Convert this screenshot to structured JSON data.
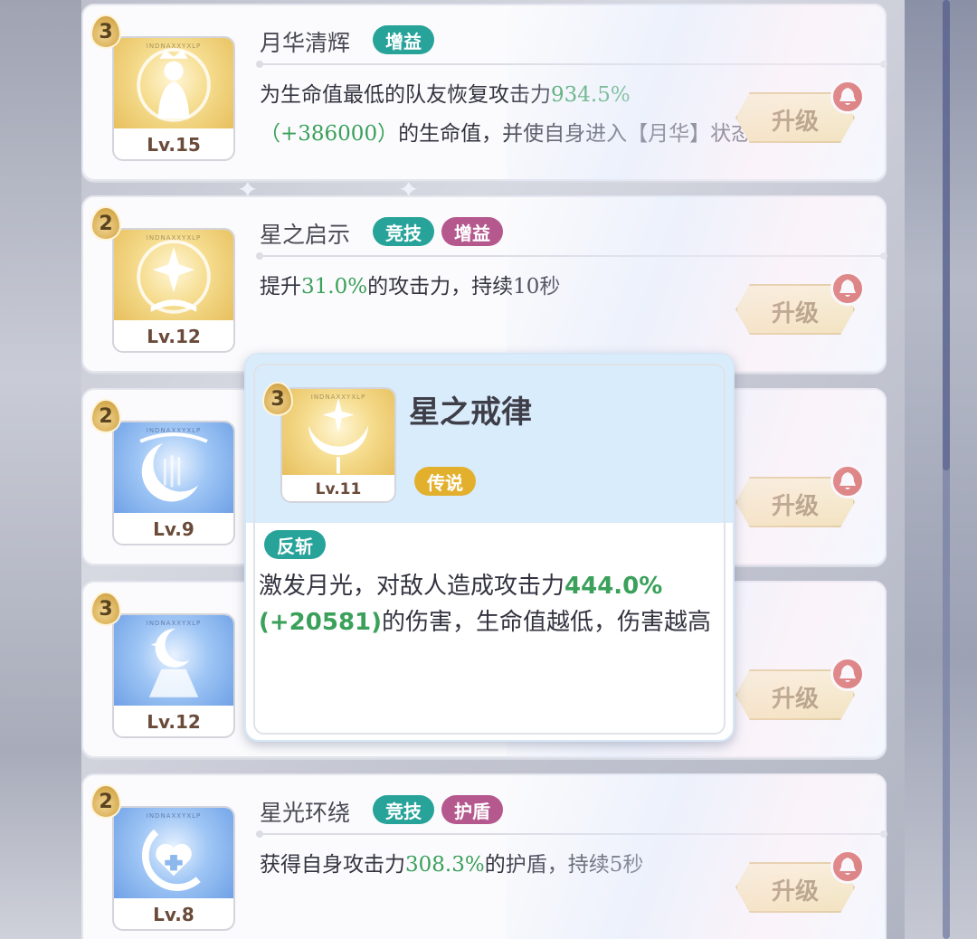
{
  "skills": [
    {
      "tier": "3",
      "name": "月华清辉",
      "icon_code": "INDNAXXYXLP",
      "level": "Lv.15",
      "tags": [
        {
          "label": "增益",
          "color": "teal"
        }
      ],
      "desc": {
        "pre": "为生命值最低的队友恢复攻击力",
        "hl": "934.5%（+386000）",
        "post": "的生命值，并使自身进入【月华】状态"
      },
      "icon": "praying-maiden-icon",
      "theme": "gold"
    },
    {
      "tier": "2",
      "name": "星之启示",
      "icon_code": "INDNAXXYXLP",
      "level": "Lv.12",
      "tags": [
        {
          "label": "竞技",
          "color": "teal"
        },
        {
          "label": "增益",
          "color": "purple"
        }
      ],
      "desc": {
        "pre": "提升",
        "hl": "31.0%",
        "post": "的攻击力，持续10秒"
      },
      "icon": "sparkle-book-icon",
      "theme": "gold"
    },
    {
      "tier": "2",
      "icon_code": "INDNAXXYXLP",
      "level": "Lv.9",
      "icon": "crescent-moon-icon",
      "theme": "blue"
    },
    {
      "tier": "3",
      "icon_code": "INDNAXXYXLP",
      "level": "Lv.12",
      "icon": "moon-pendant-icon",
      "theme": "blue"
    },
    {
      "tier": "2",
      "name": "星光环绕",
      "icon_code": "INDNAXXYXLP",
      "level": "Lv.8",
      "tags": [
        {
          "label": "竞技",
          "color": "teal"
        },
        {
          "label": "护盾",
          "color": "purple"
        }
      ],
      "desc": {
        "pre": "获得自身攻击力",
        "hl": "308.3%",
        "post": "的护盾，持续5秒"
      },
      "icon": "heart-cross-icon",
      "theme": "blue"
    }
  ],
  "upgrade_label": "升级",
  "popup": {
    "tier": "3",
    "icon_code": "INDNAXXYXLP",
    "level": "Lv.11",
    "name": "星之戒律",
    "rarity": "传说",
    "type": "反斩",
    "desc": {
      "pre": "激发月光，对敌人造成攻击力",
      "hl": "444.0%(+20581)",
      "post": "的伤害，生命值越低，伤害越高"
    },
    "icon": "star-crescent-icon"
  },
  "colors": {
    "teal": "#27a39a",
    "purple": "#b4588e",
    "gold": "#e3b02e",
    "highlight": "#3aa05a",
    "bell": "#cf3b34"
  }
}
